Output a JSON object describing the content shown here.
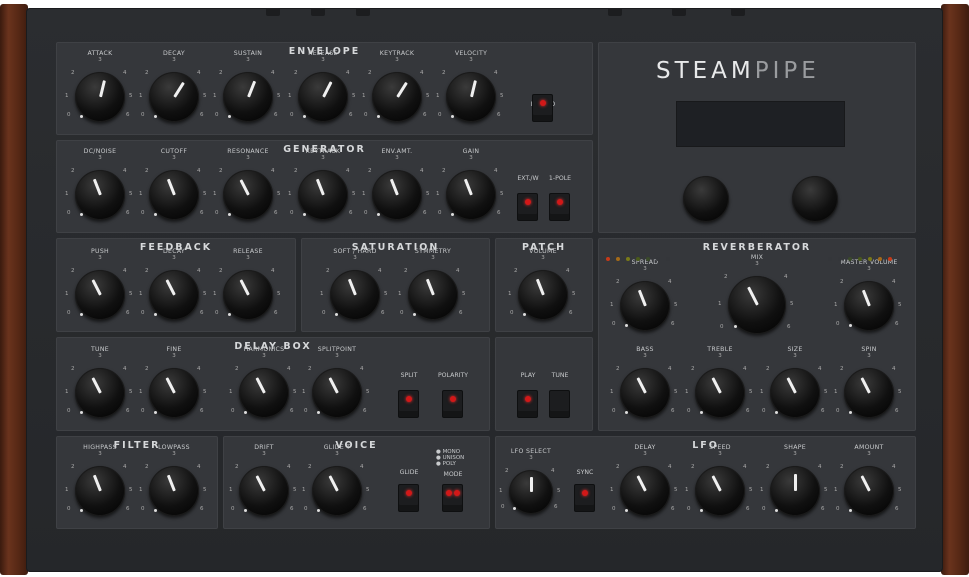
{
  "brand": {
    "name_a": "STEAM",
    "name_b": "PIPE"
  },
  "colors": {
    "chassis": "#2b2d30",
    "panel": "#35373b",
    "led": "#d21818",
    "wood": "#5a2a16"
  },
  "scale": {
    "min": "0",
    "n1": "1",
    "n2": "2",
    "n3": "3",
    "n4": "4",
    "n5": "5",
    "max": "6"
  },
  "sections": {
    "envelope": "ENVELOPE",
    "generator": "GENERATOR",
    "feedback": "FEEDBACK",
    "saturation": "SATURATION",
    "patch": "PATCH",
    "reverberator": "REVERBERATOR",
    "delay_box": "DELAY BOX",
    "filter": "FILTER",
    "voice": "VOICE",
    "lfo": "LFO"
  },
  "knobs": {
    "attack": {
      "label": "ATTACK",
      "value": 0.55
    },
    "decay": {
      "label": "DECAY",
      "value": 0.62
    },
    "sustain": {
      "label": "SUSTAIN",
      "value": 0.58
    },
    "release": {
      "label": "RELEASE",
      "value": 0.6
    },
    "keytrack": {
      "label": "KEYTRACK",
      "value": 0.62
    },
    "velocity": {
      "label": "VELOCITY",
      "value": 0.55
    },
    "dcnoise": {
      "label": "DC/NOISE",
      "value": 0.42
    },
    "cutoff": {
      "label": "CUTOFF",
      "value": 0.42
    },
    "resonance": {
      "label": "RESONANCE",
      "value": 0.4
    },
    "gen_keytrack": {
      "label": "KEYTRACK",
      "value": 0.42
    },
    "envamt": {
      "label": "ENV.AMT.",
      "value": 0.42
    },
    "gain": {
      "label": "GAIN",
      "value": 0.42
    },
    "push": {
      "label": "PUSH",
      "value": 0.4
    },
    "fb_decay": {
      "label": "DECAY",
      "value": 0.4
    },
    "fb_release": {
      "label": "RELEASE",
      "value": 0.4
    },
    "softhard": {
      "label": "SOFT / HARD",
      "value": 0.42
    },
    "symmetry": {
      "label": "SYMMETRY",
      "value": 0.42
    },
    "volume": {
      "label": "VOLUME",
      "value": 0.42
    },
    "spread": {
      "label": "SPREAD",
      "value": 0.42
    },
    "mix": {
      "label": "MIX",
      "value": 0.4
    },
    "master_volume": {
      "label": "MASTER VOLUME",
      "value": 0.42
    },
    "bass": {
      "label": "BASS",
      "value": 0.4
    },
    "treble": {
      "label": "TREBLE",
      "value": 0.4
    },
    "size": {
      "label": "SIZE",
      "value": 0.4
    },
    "spin": {
      "label": "SPIN",
      "value": 0.4
    },
    "tune": {
      "label": "TUNE",
      "value": 0.4
    },
    "fine": {
      "label": "FINE",
      "value": 0.4
    },
    "harmonics": {
      "label": "HARMONICS",
      "value": 0.4
    },
    "splitpoint": {
      "label": "SPLITPOINT",
      "value": 0.4
    },
    "highpass": {
      "label": "HIGHPASS",
      "value": 0.42
    },
    "lowpass": {
      "label": "LOWPASS",
      "value": 0.42
    },
    "drift": {
      "label": "DRIFT",
      "value": 0.4
    },
    "glide_t": {
      "label": "GLIDE T",
      "value": 0.4
    },
    "lfo_select": {
      "label": "LFO SELECT",
      "value": 0.5
    },
    "lfo_delay": {
      "label": "DELAY",
      "value": 0.4
    },
    "speed": {
      "label": "SPEED",
      "value": 0.4
    },
    "shape": {
      "label": "SHAPE",
      "value": 0.5
    },
    "amount": {
      "label": "AMOUNT",
      "value": 0.4
    }
  },
  "buttons": {
    "legato": "LEGATO",
    "extw": "EXT./W",
    "onepole": "1-POLE",
    "split": "SPLIT",
    "polarity": "POLARITY",
    "play": "PLAY",
    "tune": "TUNE",
    "glide": "GLIDE",
    "mode": "MODE",
    "sync": "SYNC"
  },
  "mode_options": [
    "MONO",
    "UNISON",
    "POLY"
  ]
}
